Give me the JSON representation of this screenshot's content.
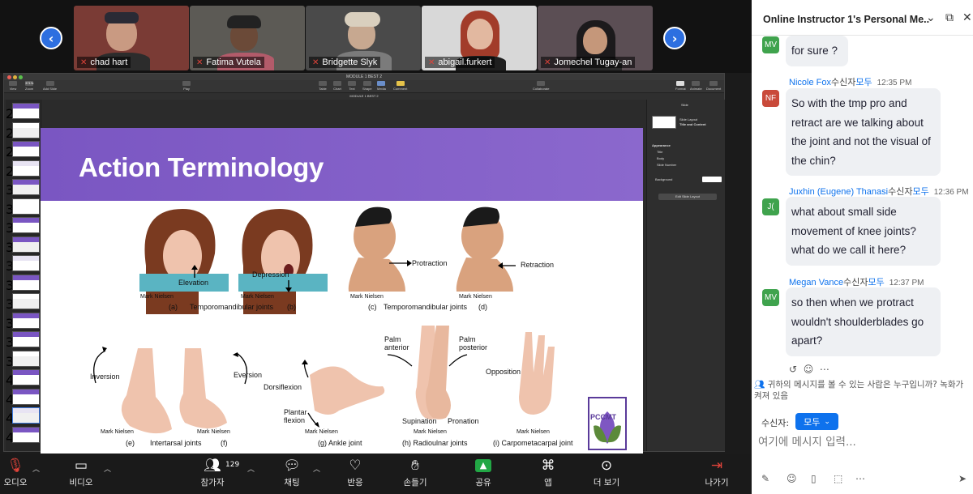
{
  "participants": [
    {
      "name": "chad hart",
      "bg": "#7a3b35"
    },
    {
      "name": "Fatima Vutela",
      "bg": "#5c5a55"
    },
    {
      "name": "Bridgette Slyk",
      "bg": "#4a4a4a"
    },
    {
      "name": "abigail.furkert",
      "bg": "#d8d8d8"
    },
    {
      "name": "Jomechel Tugay-an",
      "bg": "#5b4e54"
    }
  ],
  "strip_nav": {
    "prev": "‹",
    "next": "›"
  },
  "keynote": {
    "window_title": "MODULE 1 BEST 2",
    "doc_name": "MODULE 1 BEST 2",
    "toolbar_left": [
      "View",
      "Zoom",
      "Add Slide"
    ],
    "zoom": "371%",
    "toolbar_play": "Play",
    "toolbar_center": [
      "Table",
      "Chart",
      "Text",
      "Shape",
      "Media",
      "Comment"
    ],
    "toolbar_collab": "Collaborate",
    "toolbar_right": [
      "Format",
      "Animate",
      "Document"
    ],
    "slide_numbers": [
      "26",
      "27",
      "28",
      "29",
      "30",
      "31",
      "32",
      "33",
      "34",
      "35",
      "36",
      "37",
      "38",
      "39",
      "40",
      "41",
      "42",
      "43"
    ],
    "inspector": {
      "tab": "Slide",
      "layout_label": "Slide Layout",
      "layout_value": "Title and Content",
      "appearance": "Appearance",
      "opt_title": "Title",
      "opt_body": "Body",
      "opt_slide_number": "Slide Number",
      "background": "Background",
      "edit_layout": "Edit Slide Layout"
    }
  },
  "slide": {
    "title": "Action Terminology",
    "labels": {
      "elevation": "Elevation",
      "depression": "Depression",
      "protraction": "Protraction",
      "retraction": "Retraction",
      "inversion": "Inversion",
      "eversion": "Eversion",
      "dorsiflexion": "Dorsiflexion",
      "plantar": "Plantar\nflexion",
      "palm_anterior": "Palm\nanterior",
      "palm_posterior": "Palm\nposterior",
      "opposition": "Opposition",
      "supination": "Supination",
      "pronation": "Pronation"
    },
    "captions": {
      "a": "(a)",
      "b": "(b)",
      "tmj1": "Temporomandibular joints",
      "c": "(c)",
      "tmj2": "Temporomandibular joints",
      "d": "(d)",
      "e": "(e)",
      "intertarsal": "Intertarsal joints",
      "f": "(f)",
      "g": "(g) Ankle joint",
      "h": "(h) Radioulnar joints",
      "i": "(i) Carpometacarpal joint"
    },
    "credit": "Mark Nielsen",
    "logo_text": "PCCMT"
  },
  "toolbar": {
    "audio": "오디오",
    "video": "비디오",
    "participants": "참가자",
    "participant_count": "129",
    "chat": "채팅",
    "react": "반응",
    "raise_hand": "손들기",
    "share": "공유",
    "apps": "앱",
    "more": "더 보기",
    "leave": "나가기"
  },
  "chat": {
    "title": "Online Instructor 1's Personal Me...",
    "messages": [
      {
        "initials": "MV",
        "avatar_color": "#3fa34d",
        "name": "",
        "to": "",
        "all": "",
        "time": "",
        "text": "for sure ?"
      },
      {
        "initials": "NF",
        "avatar_color": "#c94a3a",
        "name": "Nicole Fox",
        "to": "수신자",
        "all": "모두",
        "time": "12:35 PM",
        "text": "So with the tmp pro and retract are we talking about the joint and not the visual of the chin?"
      },
      {
        "initials": "J(",
        "avatar_color": "#3fa34d",
        "name": "Juxhin (Eugene) Thanasi",
        "to": "수신자",
        "all": "모두",
        "time": "12:36 PM",
        "text": "what about small side movement of knee joints? what do we call it here?"
      },
      {
        "initials": "MV",
        "avatar_color": "#3fa34d",
        "name": "Megan Vance",
        "to": "수신자",
        "all": "모두",
        "time": "12:37 PM",
        "text": "so then when we protract wouldn't shoulderblades go apart?"
      }
    ],
    "notice": "귀하의 메시지를 볼 수 있는 사람은 누구입니까? 녹화가\n켜져 있음",
    "recipient_label": "수신자:",
    "recipient_value": "모두",
    "input_placeholder": "여기에 메시지 입력..."
  }
}
